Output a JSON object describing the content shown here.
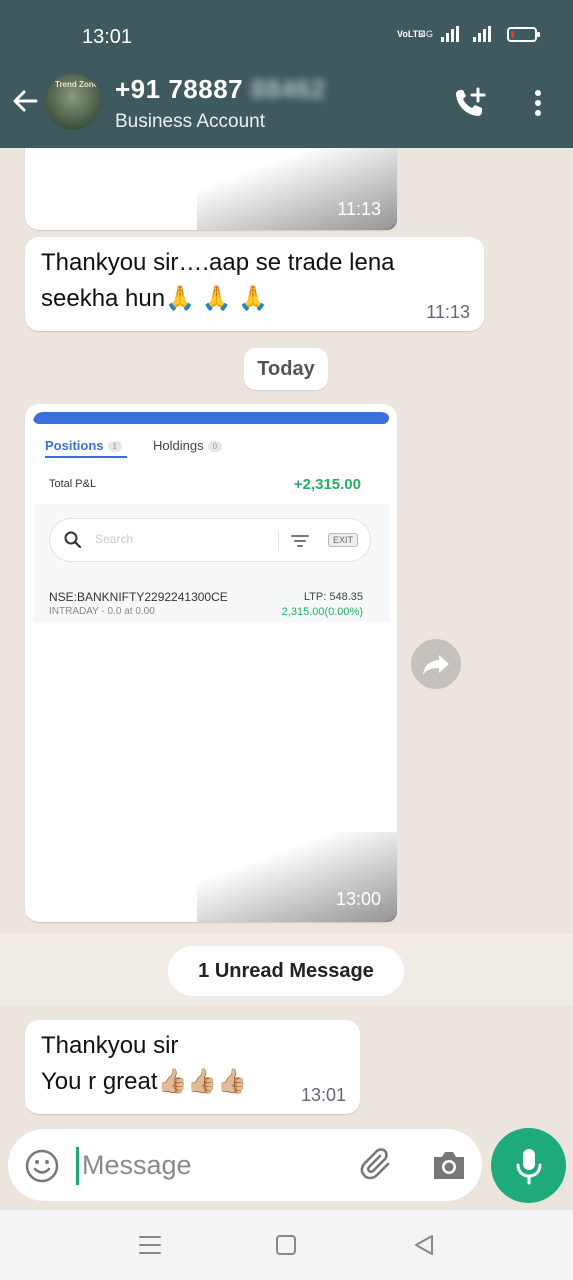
{
  "status_bar": {
    "time": "13:01",
    "network": "VoLTE",
    "net_type": "4G",
    "battery_level": 0.1,
    "battery_color": "#e53935"
  },
  "header": {
    "contact_number_visible": "+91 78887",
    "contact_number_obscured": "88462",
    "subtitle": "Business Account",
    "avatar_sign": "Trend Zone",
    "background_color": "#3e5a5e",
    "icons": [
      "back-arrow-icon",
      "add-call-icon",
      "more-vert-icon"
    ]
  },
  "chat": {
    "messages": [
      {
        "type": "image",
        "time": "11:13"
      },
      {
        "type": "text",
        "text_line1": "Thankyou sir….aap se trade lena",
        "text_line2": "seekha hun🙏 🙏 🙏",
        "time": "11:13"
      },
      {
        "type": "date_chip",
        "label": "Today"
      },
      {
        "type": "image",
        "time": "13:00",
        "screenshot": {
          "tabs": [
            {
              "label": "Positions",
              "count": "1",
              "active": true
            },
            {
              "label": "Holdings",
              "count": "0",
              "active": false
            }
          ],
          "total_pnl_label": "Total P&L",
          "total_pnl_value": "+2,315.00",
          "search_placeholder": "Search",
          "exit_label": "EXIT",
          "position": {
            "symbol": "NSE:BANKNIFTY2292241300CE",
            "product": "INTRADAY -  0.0 at 0.00",
            "ltp": "LTP: 548.35",
            "change": "2,315.00(0.00%)"
          }
        }
      },
      {
        "type": "unread_chip",
        "label": "1 Unread Message"
      },
      {
        "type": "text",
        "text_line1": "Thankyou sir",
        "text_line2": "You r great👍🏼👍🏼👍🏼",
        "time": "13:01"
      }
    ]
  },
  "input_bar": {
    "placeholder": "Message",
    "icons": [
      "emoji-icon",
      "attach-icon",
      "camera-icon",
      "mic-icon"
    ],
    "accent_color": "#1faa7c"
  },
  "nav_bar": {
    "icons": [
      "recents-menu-icon",
      "home-icon",
      "back-triangle-icon"
    ]
  }
}
